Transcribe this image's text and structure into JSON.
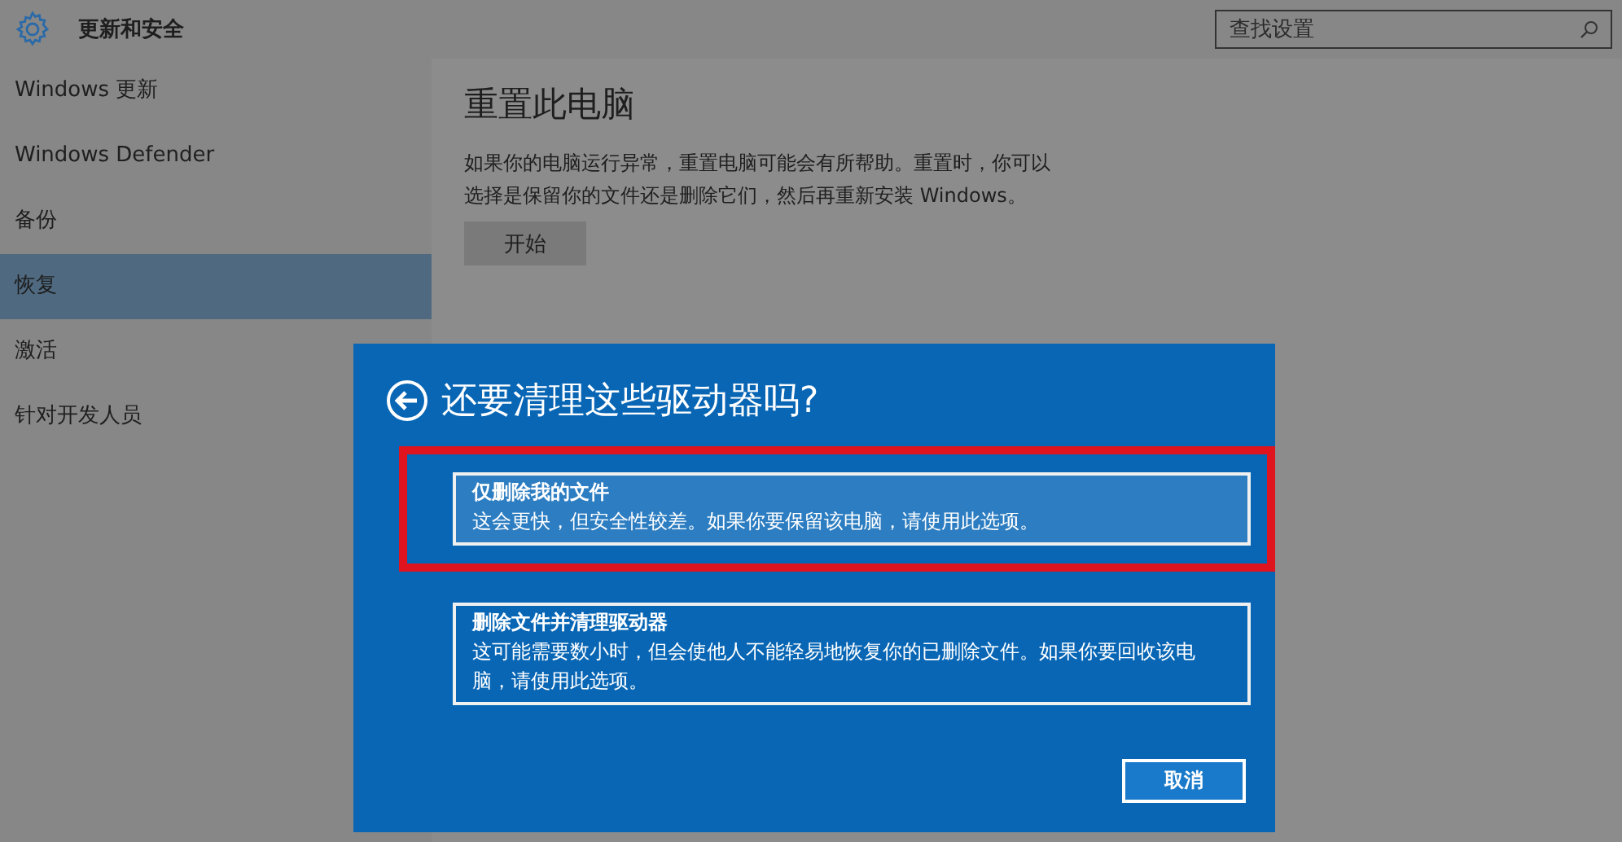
{
  "header": {
    "title": "更新和安全",
    "search": {
      "placeholder": "查找设置"
    }
  },
  "sidebar": {
    "items": [
      {
        "label": "Windows 更新",
        "selected": false
      },
      {
        "label": "Windows Defender",
        "selected": false
      },
      {
        "label": "备份",
        "selected": false
      },
      {
        "label": "恢复",
        "selected": true
      },
      {
        "label": "激活",
        "selected": false
      },
      {
        "label": "针对开发人员",
        "selected": false
      }
    ]
  },
  "content": {
    "heading": "重置此电脑",
    "description": "如果你的电脑运行异常，重置电脑可能会有所帮助。重置时，你可以选择是保留你的文件还是删除它们，然后再重新安装 Windows。",
    "button": "开始"
  },
  "dialog": {
    "title": "还要清理这些驱动器吗?",
    "options": [
      {
        "title": "仅删除我的文件",
        "description": "这会更快，但安全性较差。如果你要保留该电脑，请使用此选项。",
        "selected": true,
        "highlighted": true
      },
      {
        "title": "删除文件并清理驱动器",
        "description": "这可能需要数小时，但会使他人不能轻易地恢复你的已删除文件。如果你要回收该电脑，请使用此选项。",
        "selected": false,
        "highlighted": false
      }
    ],
    "cancel": "取消"
  }
}
